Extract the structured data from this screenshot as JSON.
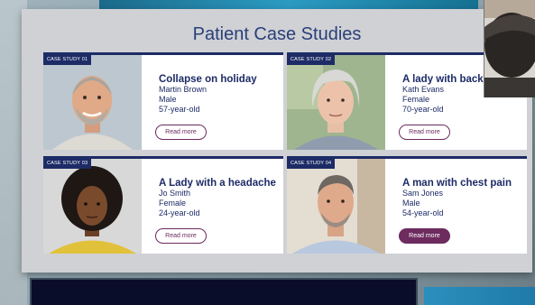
{
  "slide": {
    "title": "Patient Case Studies"
  },
  "cases": [
    {
      "tag": "CASE STUDY 01",
      "title": "Collapse on holiday",
      "name": "Martin Brown",
      "gender": "Male",
      "age": "57-year-old",
      "button": "Read more",
      "button_style": "outline"
    },
    {
      "tag": "CASE STUDY 02",
      "title": "A lady with back",
      "name": "Kath Evans",
      "gender": "Female",
      "age": "70-year-old",
      "button": "Read more",
      "button_style": "outline"
    },
    {
      "tag": "CASE STUDY 03",
      "title": "A Lady with a headache",
      "name": "Jo Smith",
      "gender": "Female",
      "age": "24-year-old",
      "button": "Read more",
      "button_style": "outline"
    },
    {
      "tag": "CASE STUDY 04",
      "title": "A man with chest pain",
      "name": "Sam Jones",
      "gender": "Male",
      "age": "54-year-old",
      "button": "Read more",
      "button_style": "filled"
    }
  ],
  "colors": {
    "navy": "#1d2b66",
    "accent_plum": "#6d2b5e",
    "slide_bg": "#cfd1d4"
  }
}
